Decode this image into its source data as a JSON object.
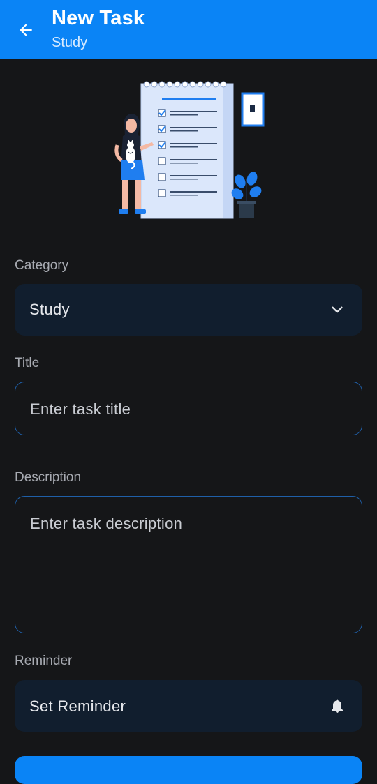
{
  "header": {
    "title": "New Task",
    "subtitle": "Study",
    "back_icon": "arrow-left-icon",
    "background_color": "#0a84f6"
  },
  "illustration": {
    "name": "task-checklist-illustration"
  },
  "form": {
    "category": {
      "label": "Category",
      "value": "Study",
      "icon": "chevron-down-icon"
    },
    "title": {
      "label": "Title",
      "placeholder": "Enter task title"
    },
    "description": {
      "label": "Description",
      "placeholder": "Enter task description"
    },
    "reminder": {
      "label": "Reminder",
      "value": "Set Reminder",
      "icon": "bell-icon"
    }
  },
  "colors": {
    "accent": "#0a84f6",
    "background": "#151618",
    "field_background": "#111e2e",
    "outline": "#1f5fa8"
  }
}
